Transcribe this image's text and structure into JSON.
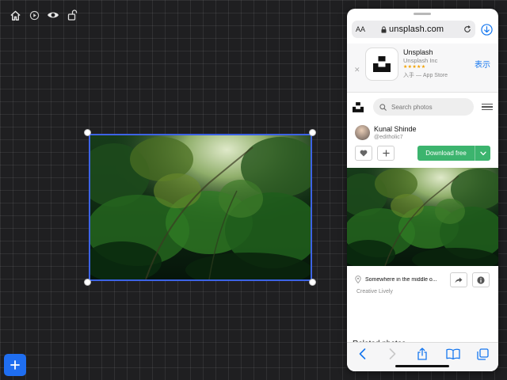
{
  "safari": {
    "reader_label": "AA",
    "url": "unsplash.com"
  },
  "app_banner": {
    "app_name": "Unsplash",
    "developer": "Unsplash Inc",
    "stars": "★★★★★",
    "store_line": "入手 — App Store",
    "open_label": "表示"
  },
  "site": {
    "search_placeholder": "Search photos"
  },
  "photo": {
    "author_name": "Kunal Shinde",
    "author_handle": "@editholic7",
    "download_label": "Download free",
    "location": "Somewhere in the middle o...",
    "license": "Creative Lively"
  },
  "related_heading": "Related photos",
  "colors": {
    "accent": "#1f6ef0",
    "selection": "#3d63e6",
    "download_green": "#3cb46e",
    "safari_blue": "#1677ef"
  }
}
